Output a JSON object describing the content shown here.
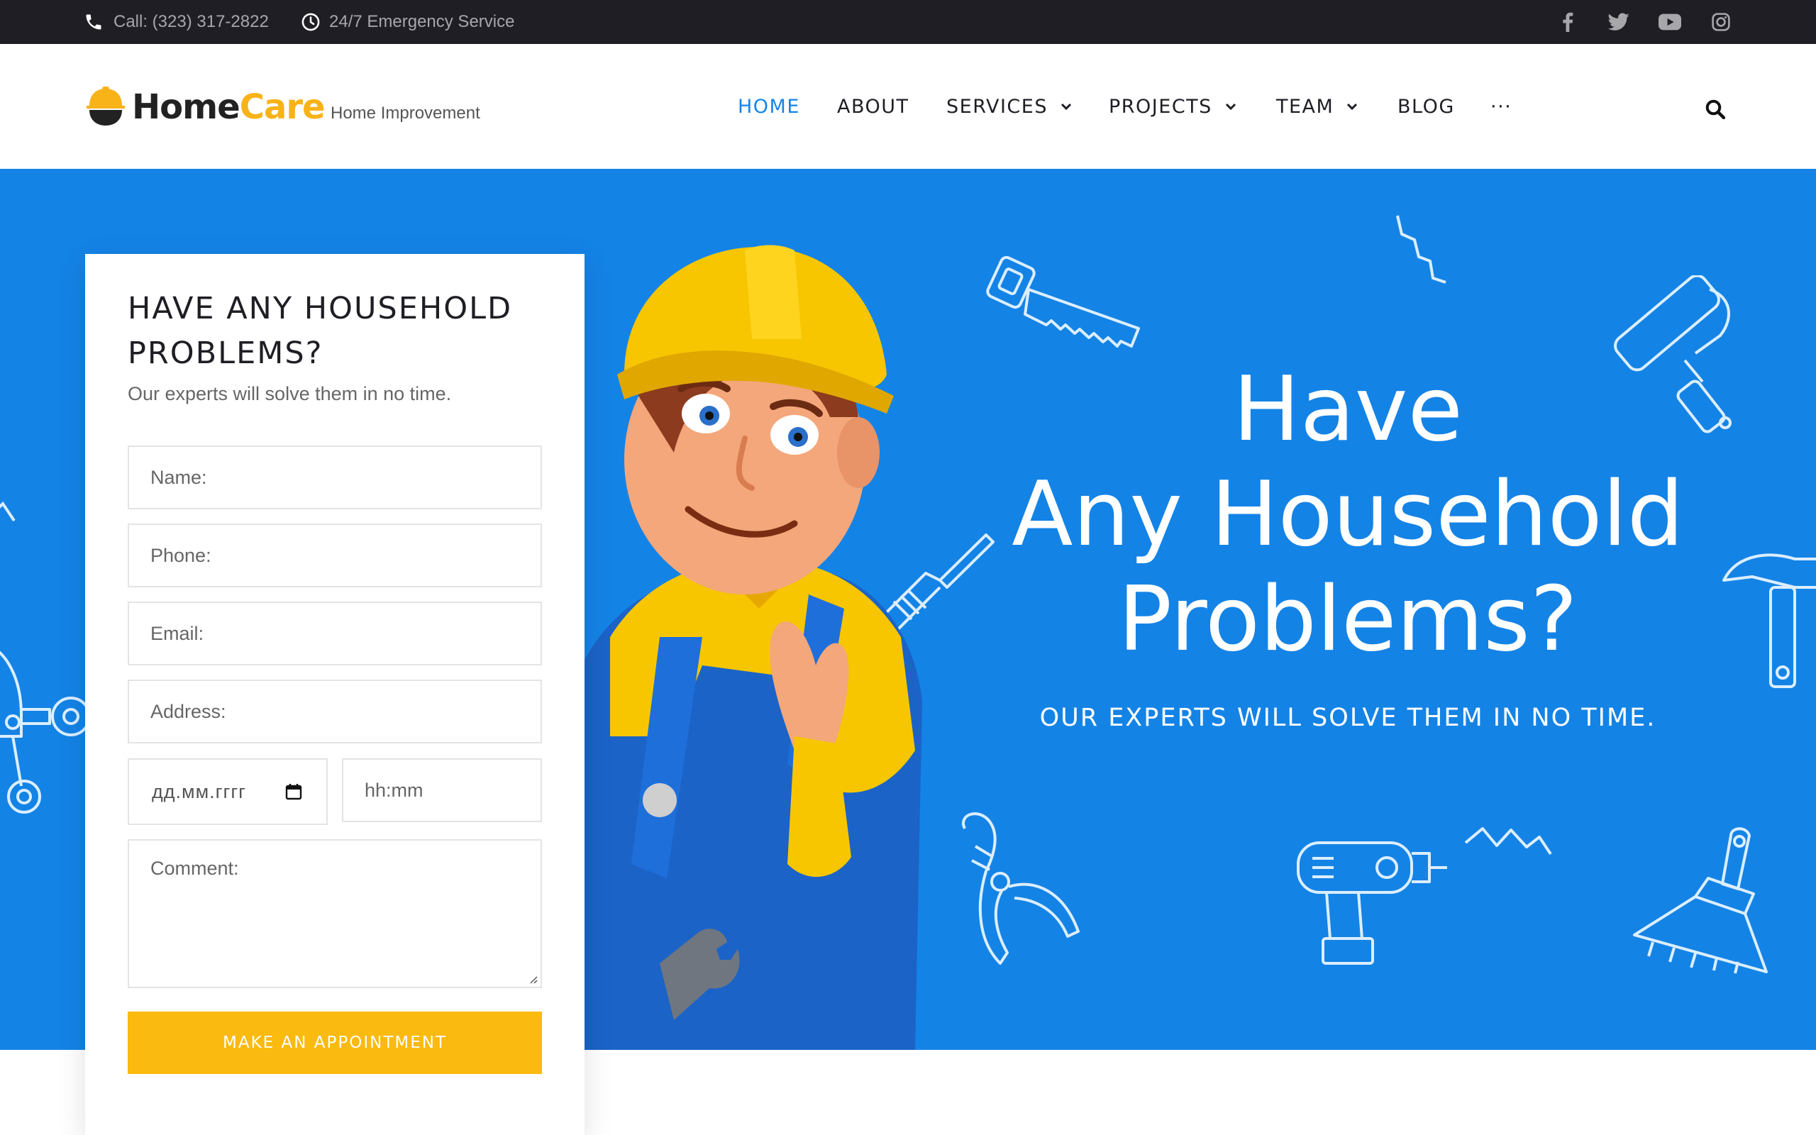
{
  "topbar": {
    "phone_icon": "phone-icon",
    "phone_text": "Call:  (323) 317-2822",
    "service_icon": "clock-icon",
    "service_text": "24/7 Emergency Service",
    "social": [
      "facebook-icon",
      "twitter-icon",
      "youtube-icon",
      "instagram-icon"
    ]
  },
  "header": {
    "logo_home": "Home",
    "logo_care": "Care",
    "tagline": "Home Improvement",
    "nav": [
      {
        "label": "HOME",
        "active": true
      },
      {
        "label": "ABOUT"
      },
      {
        "label": "SERVICES",
        "dropdown": true
      },
      {
        "label": "PROJECTS",
        "dropdown": true
      },
      {
        "label": "TEAM",
        "dropdown": true
      },
      {
        "label": "BLOG"
      },
      {
        "label": "···"
      }
    ],
    "search_icon": "search-icon"
  },
  "hero": {
    "title_lines": [
      "Have",
      "Any Household",
      "Problems?"
    ],
    "subtitle": "OUR EXPERTS WILL SOLVE THEM IN NO TIME."
  },
  "form": {
    "title": "HAVE ANY HOUSEHOLD PROBLEMS?",
    "subtitle": "Our experts will solve them in no time.",
    "name_placeholder": "Name:",
    "phone_placeholder": "Phone:",
    "email_placeholder": "Email:",
    "address_placeholder": "Address:",
    "date_placeholder": "дд.мм.гггг",
    "time_placeholder": "hh:mm",
    "comment_placeholder": "Comment:",
    "submit_label": "MAKE AN APPOINTMENT"
  },
  "colors": {
    "topbar_bg": "#1f1e25",
    "hero_blue": "#1483e6",
    "nav_active": "#1684e8",
    "accent_yellow": "#fbba0f",
    "logo_care": "#f8b319"
  }
}
